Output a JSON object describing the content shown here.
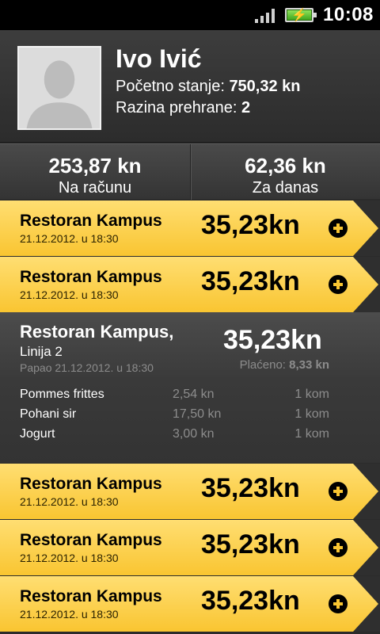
{
  "status": {
    "time": "10:08"
  },
  "profile": {
    "name": "Ivo Ivić",
    "balance_label": "Početno stanje: ",
    "balance_value": "750,32 kn",
    "level_label": "Razina prehrane: ",
    "level_value": "2"
  },
  "summary": {
    "account_value": "253,87 kn",
    "account_label": "Na računu",
    "today_value": "62,36 kn",
    "today_label": "Za danas"
  },
  "transactions": [
    {
      "title": "Restoran Kampus",
      "date": "21.12.2012. u 18:30",
      "amount": "35,23kn"
    },
    {
      "title": "Restoran Kampus",
      "date": "21.12.2012. u 18:30",
      "amount": "35,23kn"
    },
    {
      "title": "Restoran Kampus",
      "date": "21.12.2012. u 18:30",
      "amount": "35,23kn"
    },
    {
      "title": "Restoran Kampus",
      "date": "21.12.2012. u 18:30",
      "amount": "35,23kn"
    },
    {
      "title": "Restoran Kampus",
      "date": "21.12.2012. u 18:30",
      "amount": "35,23kn"
    }
  ],
  "expanded": {
    "title": "Restoran Kampus,",
    "subtitle": "Linija 2",
    "date": "Papao 21.12.2012. u 18:30",
    "amount": "35,23kn",
    "paid_label": "Plaćeno: ",
    "paid_value": "8,33 kn",
    "items": [
      {
        "name": "Pommes frittes",
        "price": "2,54 kn",
        "qty": "1 kom"
      },
      {
        "name": "Pohani sir",
        "price": "17,50 kn",
        "qty": "1 kom"
      },
      {
        "name": "Jogurt",
        "price": "3,00 kn",
        "qty": "1 kom"
      }
    ]
  },
  "colors": {
    "row_yellow": "#f9c531",
    "row_yellow_light": "#ffde72",
    "background": "#2b2b2b"
  },
  "icons": {
    "signal": "signal-icon",
    "battery": "battery-charging-icon",
    "add": "plus-circle-icon",
    "avatar": "avatar-placeholder"
  }
}
